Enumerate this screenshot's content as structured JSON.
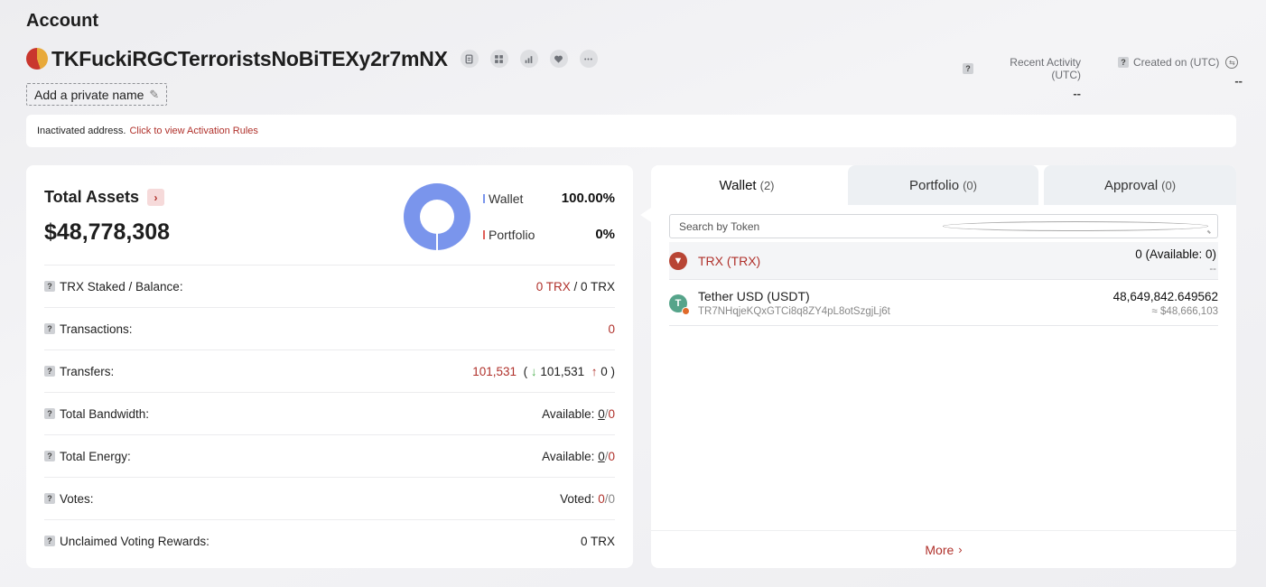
{
  "header": {
    "title": "Account",
    "address": "TKFuckiRGCTerroristsNoBiTEXy2r7mNX",
    "private_name_label": "Add a private name",
    "recent_activity_label": "Recent Activity (UTC)",
    "recent_activity_value": "--",
    "created_on_label": "Created on (UTC)",
    "created_on_value": "--"
  },
  "notice": {
    "text": "Inactivated address.",
    "link": "Click to view Activation Rules"
  },
  "assets": {
    "title": "Total Assets",
    "value": "$48,778,308",
    "legend": [
      {
        "name": "Wallet",
        "pct": "100.00%",
        "color": "#7a95ec"
      },
      {
        "name": "Portfolio",
        "pct": "0%",
        "color": "#e0605a"
      }
    ],
    "donut_share": {
      "wallet": 1.0,
      "portfolio": 0.0
    }
  },
  "stats": {
    "trx_staked": {
      "label": "TRX Staked / Balance:",
      "staked": "0 TRX",
      "balance": " / 0 TRX"
    },
    "transactions": {
      "label": "Transactions:",
      "value": "0"
    },
    "transfers": {
      "label": "Transfers:",
      "total": "101,531",
      "open": "(",
      "in": "101,531",
      "out": "0",
      "close": ")"
    },
    "bandwidth": {
      "label": "Total Bandwidth:",
      "prefix": "Available:",
      "available": "0",
      "sep": " / ",
      "total": "0"
    },
    "energy": {
      "label": "Total Energy:",
      "prefix": "Available:",
      "available": "0",
      "sep": " / ",
      "total": "0"
    },
    "votes": {
      "label": "Votes:",
      "prefix": "Voted:",
      "voted": "0",
      "sep": " / ",
      "total": "0"
    },
    "rewards": {
      "label": "Unclaimed Voting Rewards:",
      "value": "0 TRX"
    }
  },
  "tabs": {
    "wallet": {
      "label": "Wallet",
      "count": "(2)"
    },
    "portfolio": {
      "label": "Portfolio",
      "count": "(0)"
    },
    "approval": {
      "label": "Approval",
      "count": "(0)"
    }
  },
  "search": {
    "placeholder": "Search by Token"
  },
  "tokens": [
    {
      "name": "TRX (TRX)",
      "amount": "0 (Available: 0)",
      "fiat": "--",
      "icon": "tron-icon"
    },
    {
      "name": "Tether USD (USDT)",
      "contract": "TR7NHqjeKQxGTCi8q8ZY4pL8otSzgjLj6t",
      "amount": "48,649,842.649562",
      "fiat": "≈ $48,666,103",
      "icon": "tether-icon"
    }
  ],
  "more_label": "More"
}
